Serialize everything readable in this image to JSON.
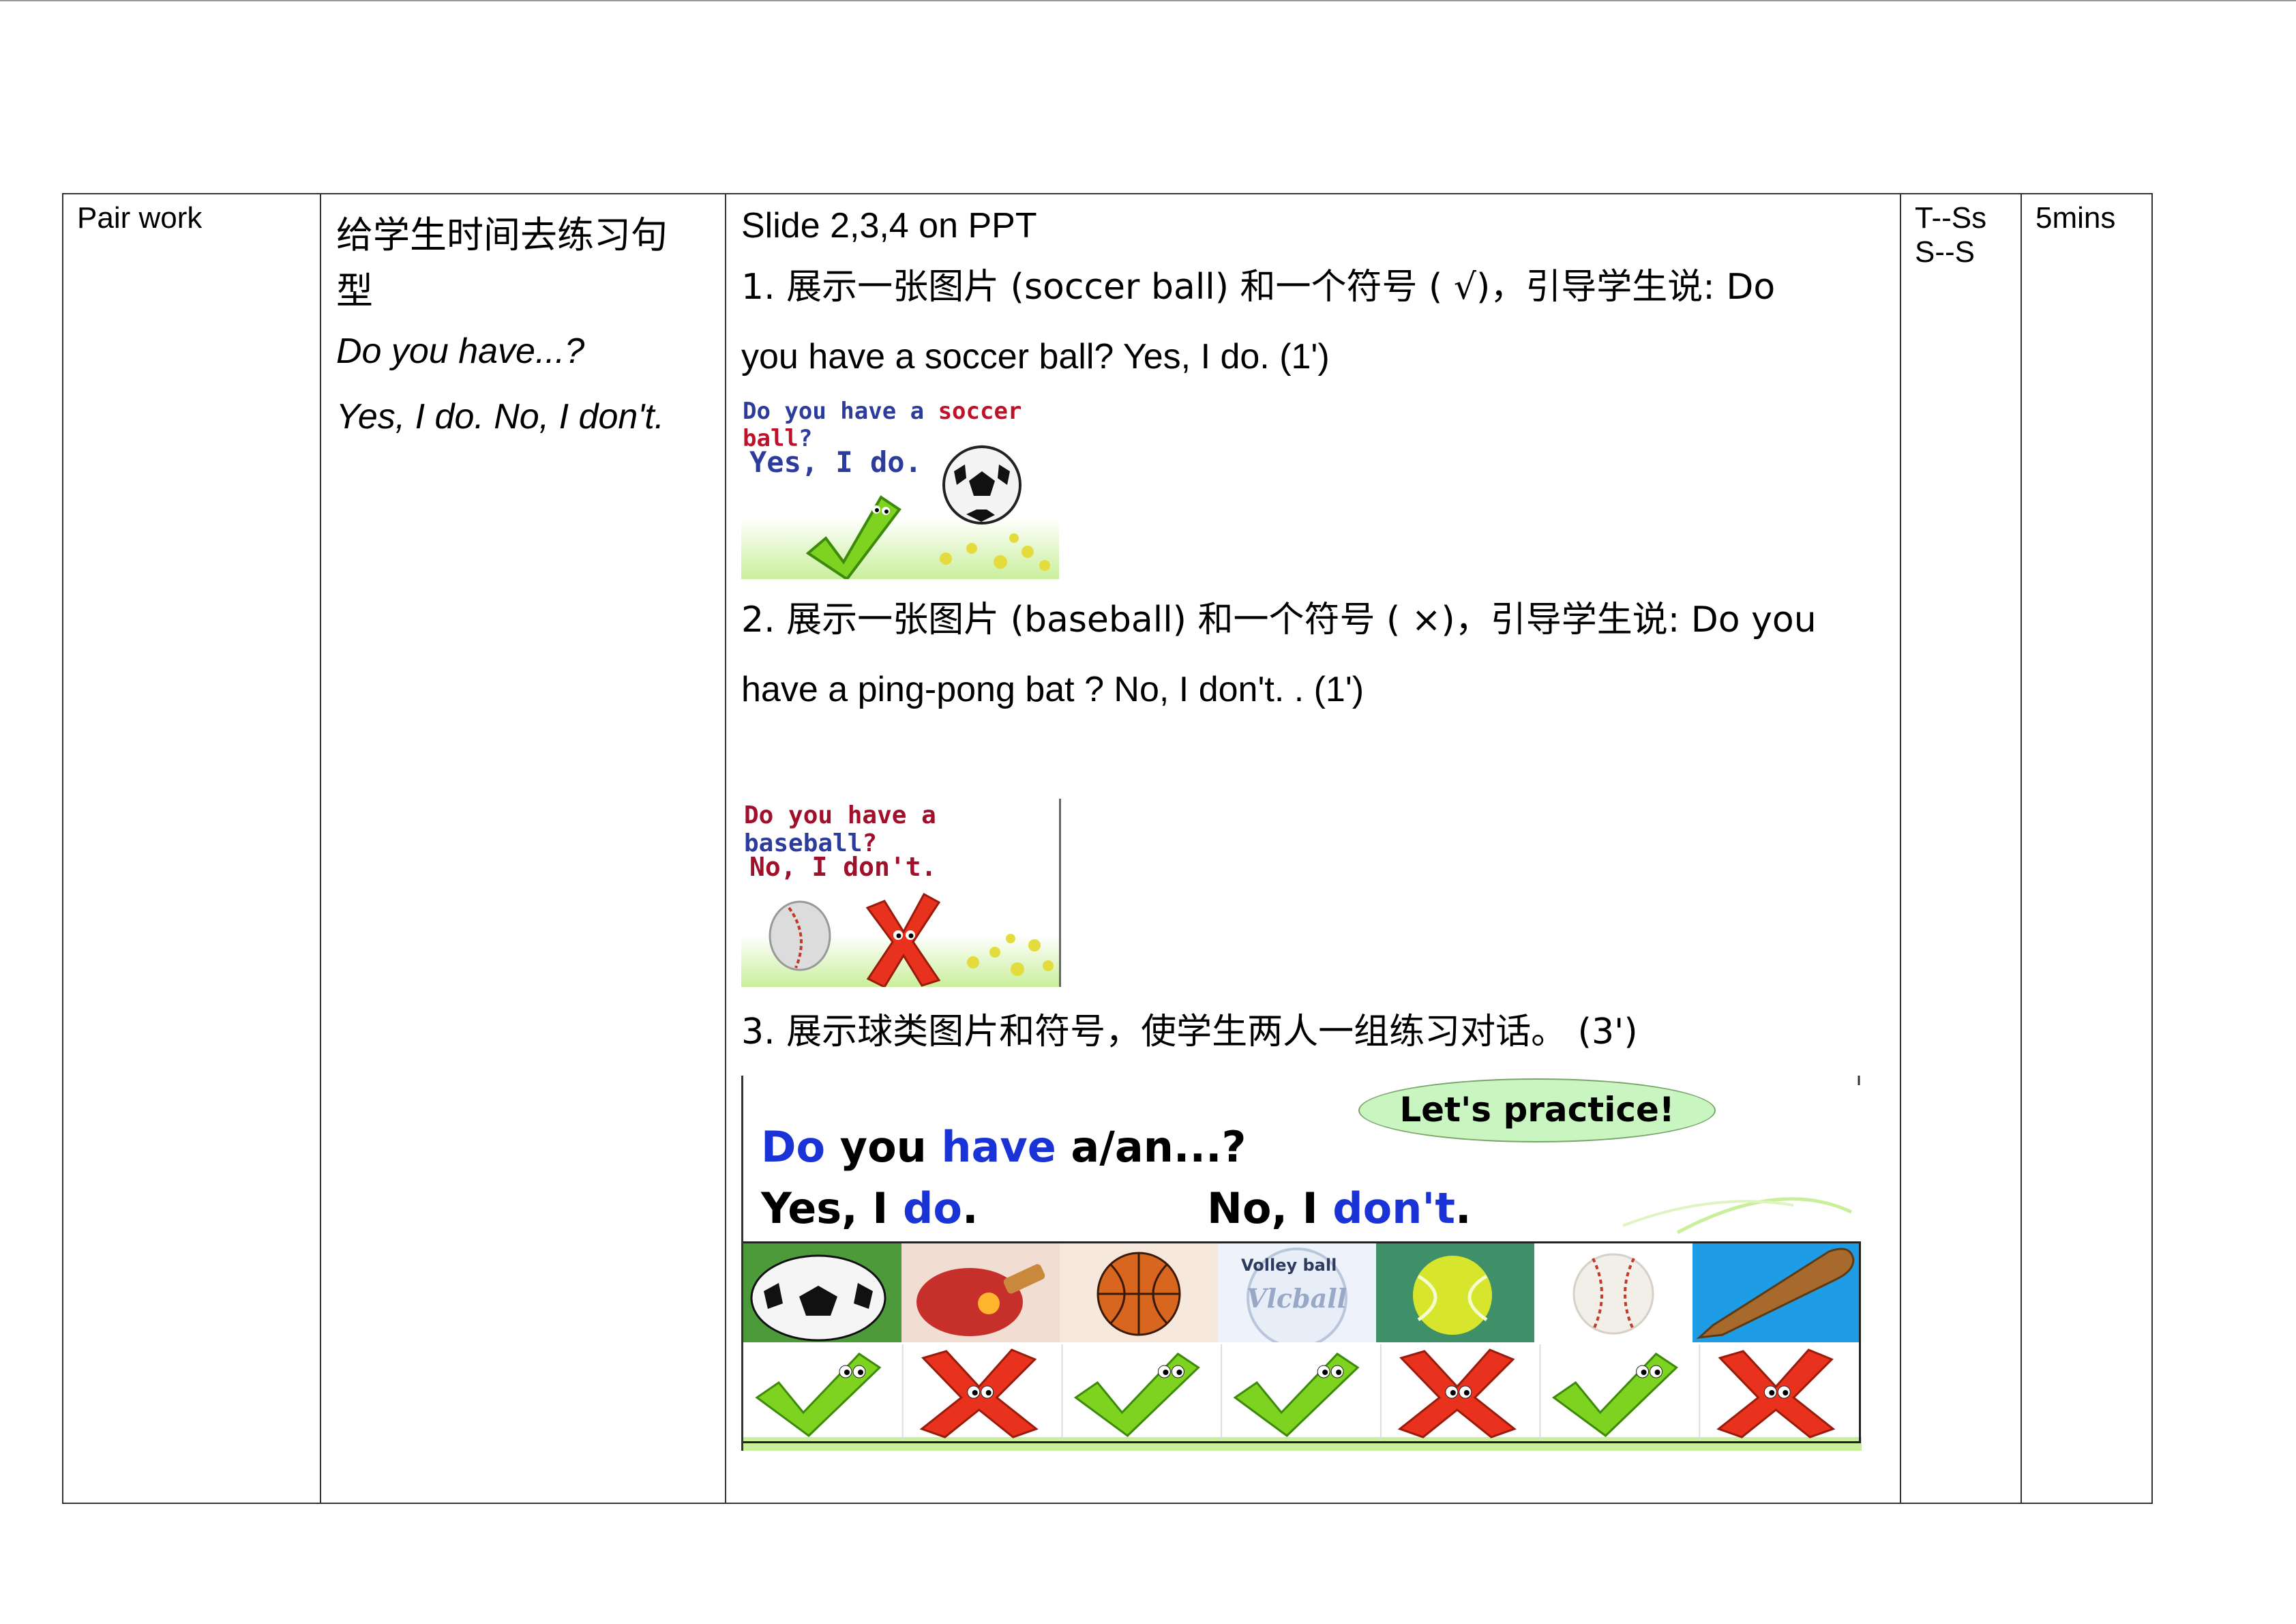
{
  "row": {
    "activity": "Pair work",
    "purpose_line1": "给学生时间去练习句",
    "purpose_line2": "型",
    "pattern_q": "Do you have...?",
    "pattern_a": "Yes, I do. No, I don't.",
    "slide_ref": "Slide 2,3,4 on PPT",
    "step1_line1": "1. 展示一张图片 (soccer ball) 和一个符号 ( √)，引导学生说: Do",
    "step1_line2": "you have a soccer ball?  Yes, I do.   (1')",
    "slide1": {
      "q_prefix": "Do you have a ",
      "q_item": "soccer ball",
      "q_mark": "?",
      "answer": "Yes, I do."
    },
    "step2_line1": "2. 展示一张图片 (baseball) 和一个符号 ( ×)，引导学生说: Do you",
    "step2_line2": "have a ping-pong bat ? No, I don't. .   (1')",
    "slide2": {
      "q_prefix": "Do you have a ",
      "q_item": "baseball",
      "q_mark": "?",
      "answer": "No, I don't."
    },
    "step3_line": "3.  展示球类图片和符号，使学生两人一组练习对话。     (3')",
    "slide3": {
      "banner": "Let's practice!",
      "q_do": "Do",
      "q_you": " you ",
      "q_have": "have",
      "q_rest": " a/an...?",
      "yes_a": "Yes, I ",
      "yes_b": "do",
      "yes_c": ".",
      "no_a": "No, I ",
      "no_b": "don't",
      "no_c": ".",
      "volley_label1": "Volley ball",
      "volley_label2": "Vlcball",
      "items": [
        "soccer-ball",
        "ping-pong-bat",
        "basketball",
        "volleyball",
        "tennis-ball",
        "baseball",
        "baseball-bat"
      ],
      "marks": [
        "check",
        "cross",
        "check",
        "check",
        "cross",
        "check",
        "cross"
      ]
    },
    "interaction_1": "T--Ss",
    "interaction_2": "S--S",
    "time": "5mins"
  },
  "colors": {
    "check_green": "#7ed321",
    "cross_red": "#e8321e",
    "slide_blue": "#1a33d6"
  }
}
